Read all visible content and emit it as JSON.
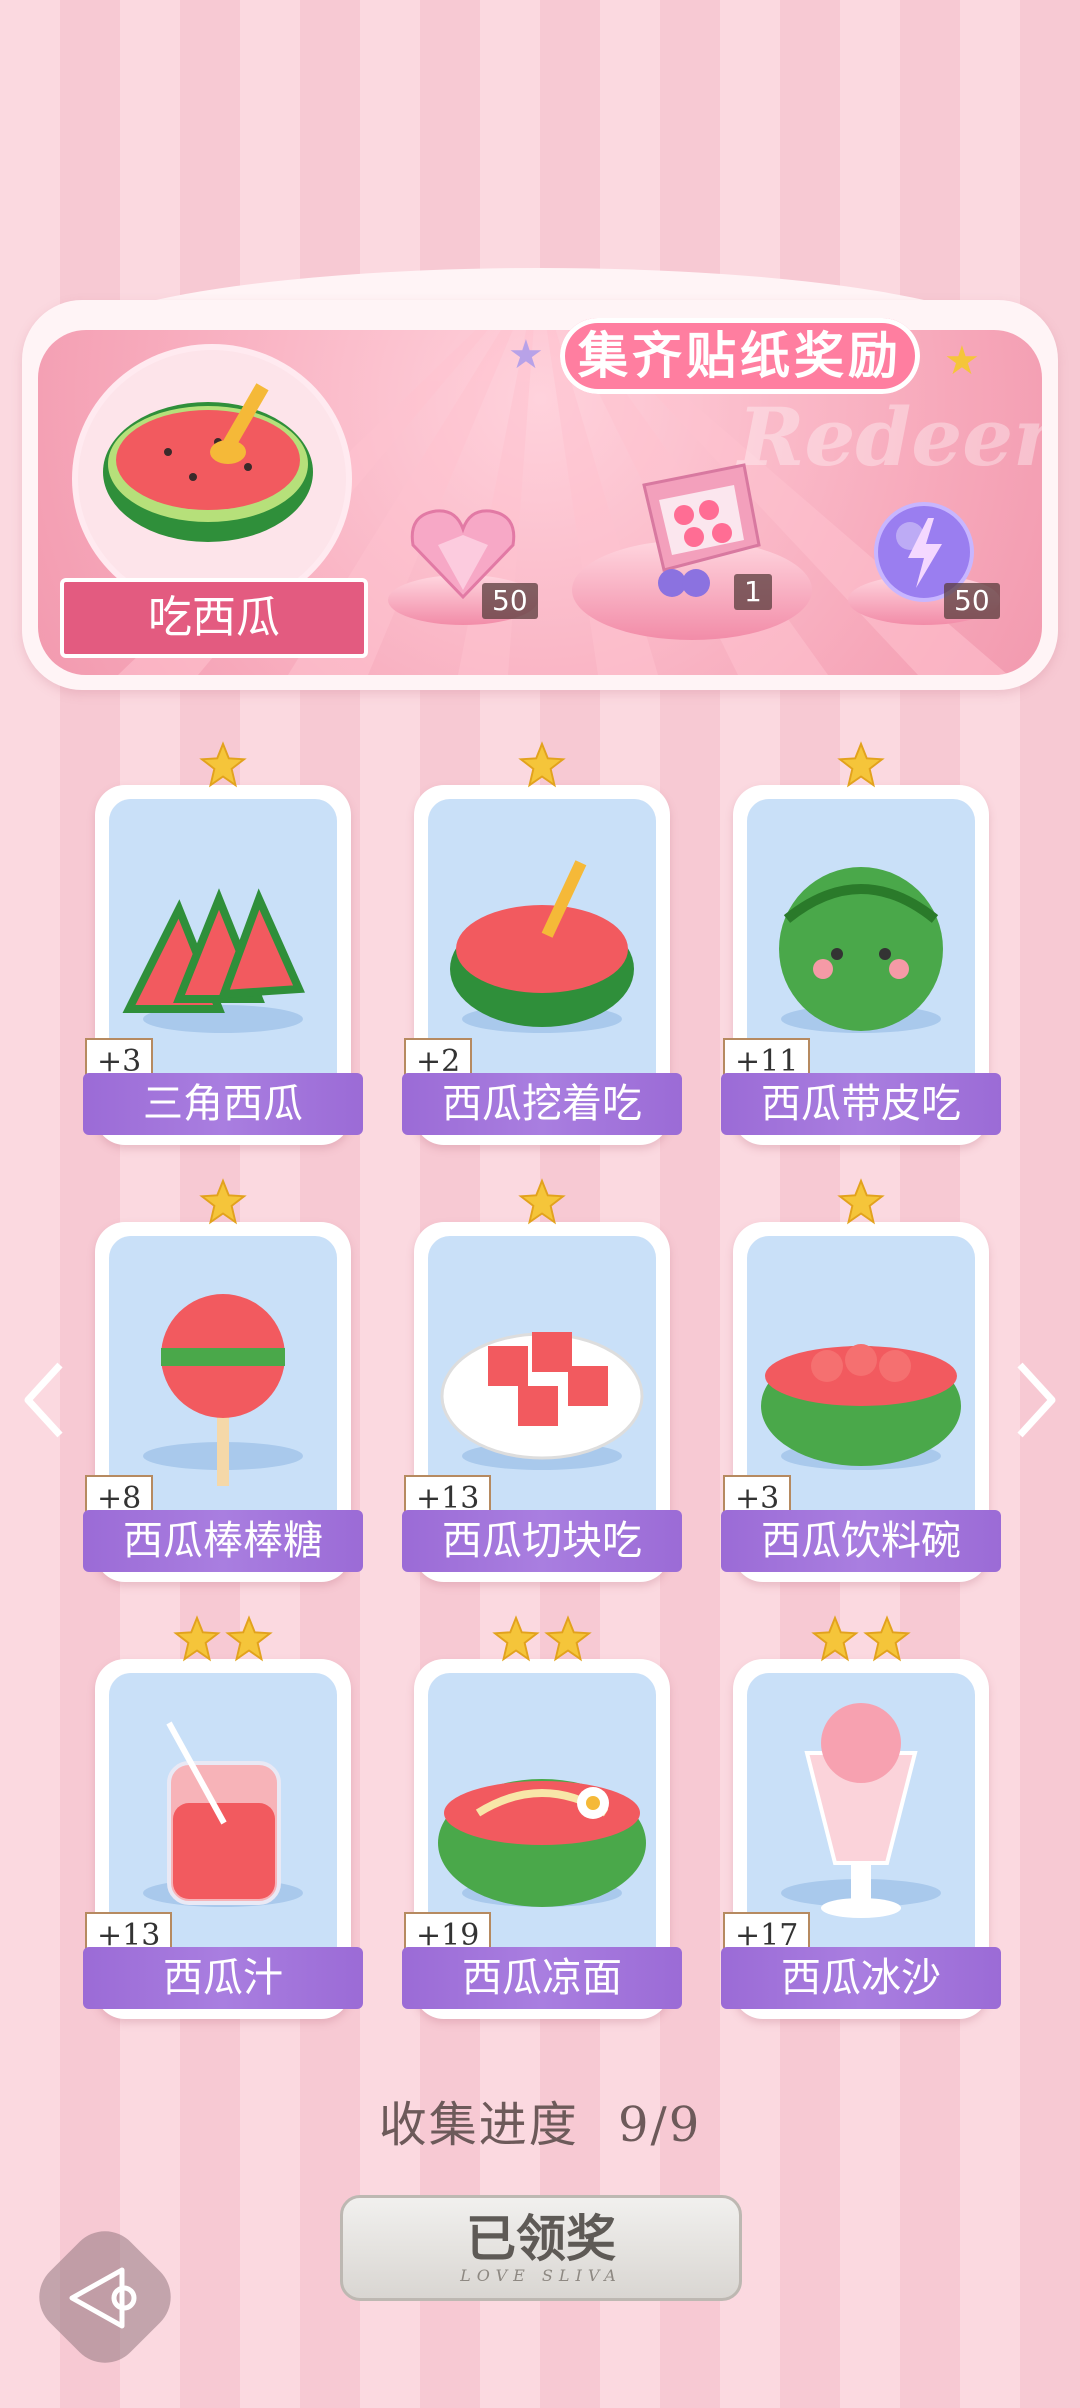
{
  "reward_panel": {
    "title": "集齐贴纸奖励",
    "watermark": "Redeem",
    "feature_name": "吃西瓜",
    "rewards": [
      {
        "icon": "heart-gem-icon",
        "count": "50"
      },
      {
        "icon": "gift-box-icon",
        "count": "1"
      },
      {
        "icon": "lightning-orb-icon",
        "count": "50"
      }
    ]
  },
  "cards": [
    {
      "name": "三角西瓜",
      "bonus": "+3",
      "stars": 1,
      "art": "watermelon-slices-icon"
    },
    {
      "name": "西瓜挖着吃",
      "bonus": "+2",
      "stars": 1,
      "art": "watermelon-half-spoon-icon"
    },
    {
      "name": "西瓜带皮吃",
      "bonus": "+11",
      "stars": 1,
      "art": "watermelon-whole-icon"
    },
    {
      "name": "西瓜棒棒糖",
      "bonus": "+8",
      "stars": 1,
      "art": "watermelon-lollipop-icon"
    },
    {
      "name": "西瓜切块吃",
      "bonus": "+13",
      "stars": 1,
      "art": "watermelon-cubes-icon"
    },
    {
      "name": "西瓜饮料碗",
      "bonus": "+3",
      "stars": 1,
      "art": "watermelon-bowl-icon"
    },
    {
      "name": "西瓜汁",
      "bonus": "+13",
      "stars": 2,
      "art": "watermelon-juice-icon"
    },
    {
      "name": "西瓜凉面",
      "bonus": "+19",
      "stars": 2,
      "art": "watermelon-noodles-icon"
    },
    {
      "name": "西瓜冰沙",
      "bonus": "+17",
      "stars": 2,
      "art": "watermelon-smoothie-icon"
    }
  ],
  "progress": {
    "label": "收集进度",
    "value": "9/9"
  },
  "claim_button": {
    "label": "已领奖",
    "subtitle": "LOVE SLIVA"
  },
  "colors": {
    "accent_pink": "#ff7ea0",
    "label_purple": "#a97ee0",
    "card_bg": "#c9e0f8",
    "star": "#f5c53a"
  }
}
